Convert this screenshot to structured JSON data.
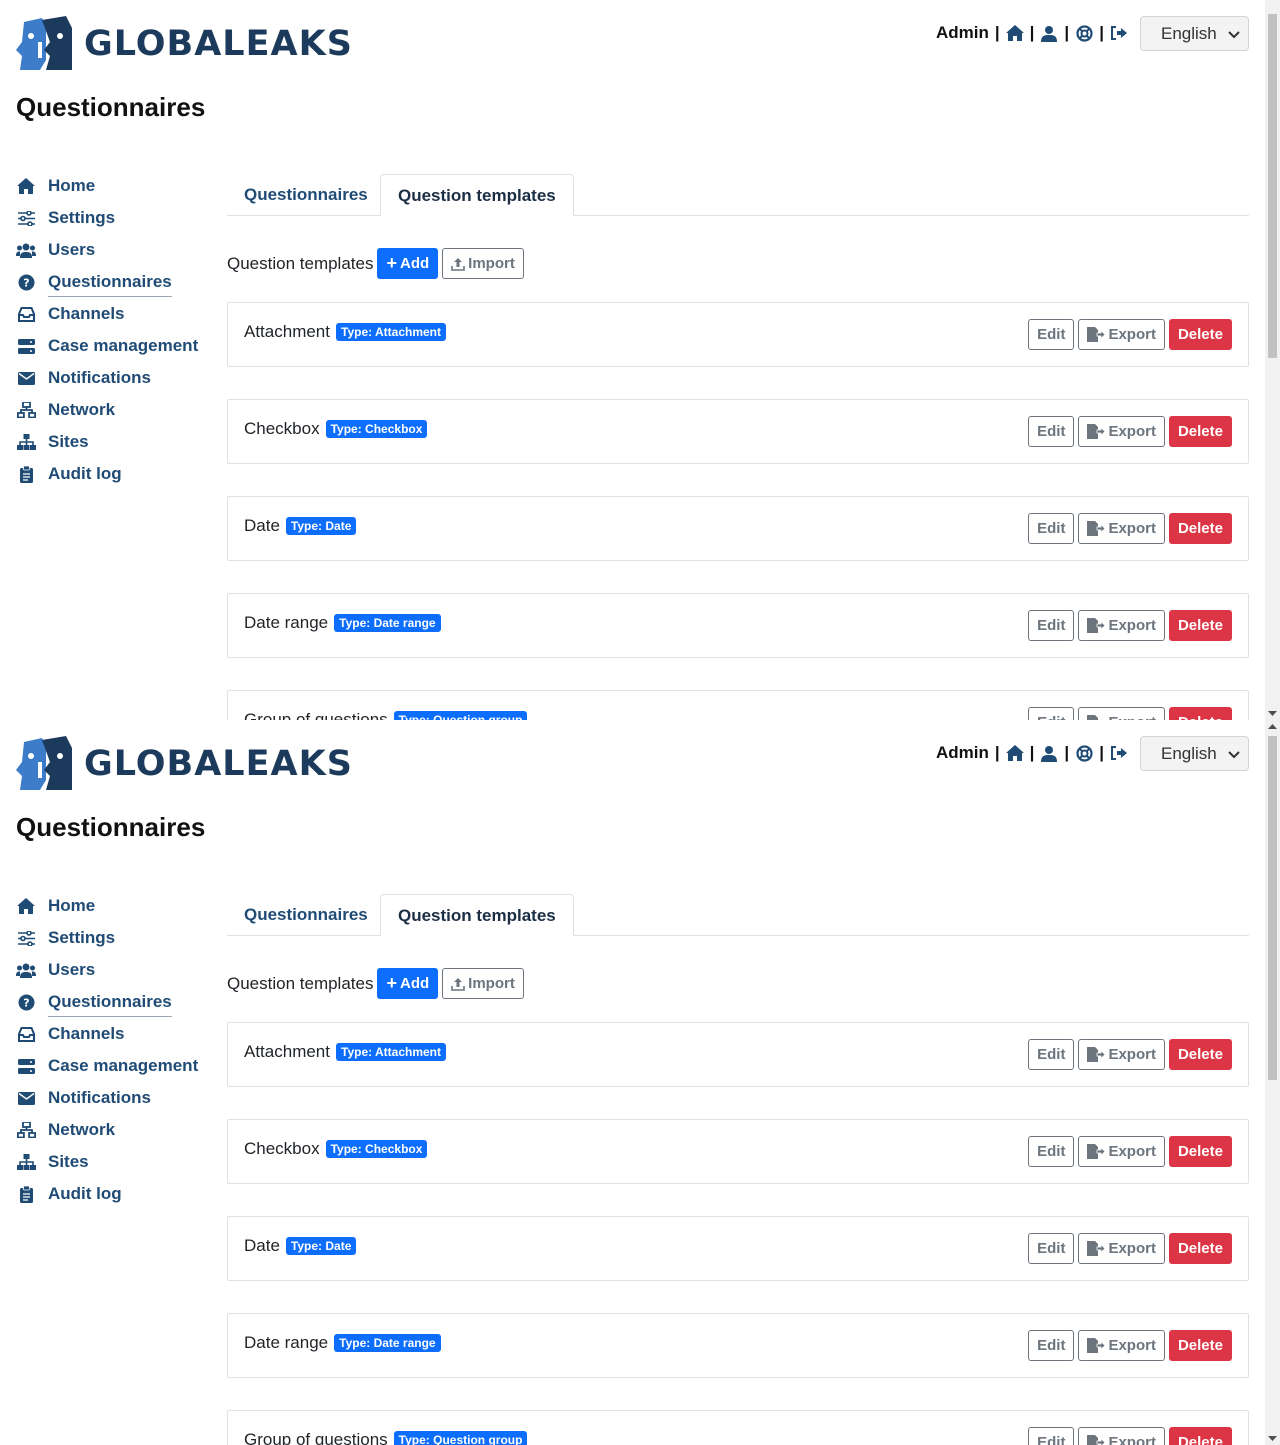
{
  "brand": {
    "logo_text": "GLOBALEAKS",
    "colors": {
      "primary_navy": "#1c3a5c",
      "link": "#1f4b75",
      "accent_blue": "#0d6efd",
      "danger": "#dc3545",
      "logo_blue": "#3d7cc9"
    }
  },
  "topnav": {
    "user_label": "Admin",
    "icons": [
      "home-icon",
      "user-icon",
      "lifebuoy-icon",
      "logout-icon"
    ],
    "language": "English"
  },
  "page_title": "Questionnaires",
  "sidebar": {
    "items": [
      {
        "label": "Home",
        "icon": "home-icon"
      },
      {
        "label": "Settings",
        "icon": "sliders-icon"
      },
      {
        "label": "Users",
        "icon": "users-icon"
      },
      {
        "label": "Questionnaires",
        "icon": "question-circle-icon",
        "active": true
      },
      {
        "label": "Channels",
        "icon": "inbox-icon"
      },
      {
        "label": "Case management",
        "icon": "server-icon"
      },
      {
        "label": "Notifications",
        "icon": "envelope-icon"
      },
      {
        "label": "Network",
        "icon": "network-icon"
      },
      {
        "label": "Sites",
        "icon": "sitemap-icon"
      },
      {
        "label": "Audit log",
        "icon": "clipboard-icon"
      }
    ]
  },
  "tabs": [
    {
      "label": "Questionnaires",
      "active": false
    },
    {
      "label": "Question templates",
      "active": true
    }
  ],
  "section": {
    "title": "Question templates",
    "add_label": "Add",
    "import_label": "Import"
  },
  "templates": [
    {
      "name": "Attachment",
      "badge": "Type: Attachment"
    },
    {
      "name": "Checkbox",
      "badge": "Type: Checkbox"
    },
    {
      "name": "Date",
      "badge": "Type: Date"
    },
    {
      "name": "Date range",
      "badge": "Type: Date range"
    },
    {
      "name": "Group of questions",
      "badge": "Type: Question group"
    }
  ],
  "actions": {
    "edit": "Edit",
    "export": "Export",
    "delete": "Delete"
  }
}
